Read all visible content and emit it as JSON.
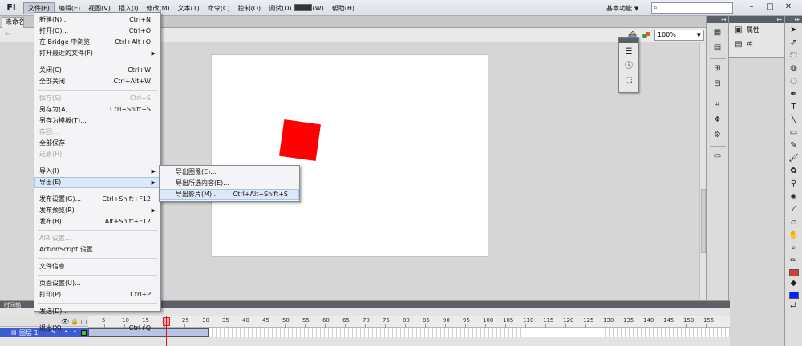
{
  "app": {
    "logo": "Fl"
  },
  "menubar": [
    {
      "label": "文件(F)"
    },
    {
      "label": "编辑(E)"
    },
    {
      "label": "视图(V)"
    },
    {
      "label": "插入(I)"
    },
    {
      "label": "修改(M)"
    },
    {
      "label": "文本(T)"
    },
    {
      "label": "命令(C)"
    },
    {
      "label": "控制(O)"
    },
    {
      "label": "调试(D)"
    },
    {
      "label": "窗口(W)"
    },
    {
      "label": "帮助(H)"
    }
  ],
  "workspace": {
    "label": "基本功能"
  },
  "search": {
    "placeholder": ""
  },
  "document": {
    "tab_label": "未命名"
  },
  "zoom": {
    "value": "100%"
  },
  "file_menu": {
    "items": [
      {
        "label": "新建(N)...",
        "shortcut": "Ctrl+N"
      },
      {
        "label": "打开(O)...",
        "shortcut": "Ctrl+O"
      },
      {
        "label": "在 Bridge 中浏览",
        "shortcut": "Ctrl+Alt+O"
      },
      {
        "label": "打开最近的文件(F)",
        "shortcut": ""
      },
      {
        "label": "关闭(C)",
        "shortcut": "Ctrl+W"
      },
      {
        "label": "全部关闭",
        "shortcut": "Ctrl+Alt+W"
      },
      {
        "label": "保存(S)",
        "shortcut": "Ctrl+S"
      },
      {
        "label": "另存为(A)...",
        "shortcut": "Ctrl+Shift+S"
      },
      {
        "label": "另存为模板(T)...",
        "shortcut": ""
      },
      {
        "label": "存回...",
        "shortcut": ""
      },
      {
        "label": "全部保存",
        "shortcut": ""
      },
      {
        "label": "还原(H)",
        "shortcut": ""
      },
      {
        "label": "导入(I)",
        "shortcut": ""
      },
      {
        "label": "导出(E)",
        "shortcut": ""
      },
      {
        "label": "发布设置(G)...",
        "shortcut": "Ctrl+Shift+F12"
      },
      {
        "label": "发布预览(R)",
        "shortcut": ""
      },
      {
        "label": "发布(B)",
        "shortcut": "Alt+Shift+F12"
      },
      {
        "label": "AIR 设置...",
        "shortcut": ""
      },
      {
        "label": "ActionScript 设置...",
        "shortcut": ""
      },
      {
        "label": "文件信息...",
        "shortcut": ""
      },
      {
        "label": "页面设置(U)...",
        "shortcut": ""
      },
      {
        "label": "打印(P)...",
        "shortcut": "Ctrl+P"
      },
      {
        "label": "发送(D)...",
        "shortcut": ""
      },
      {
        "label": "退出(X)",
        "shortcut": "Ctrl+Q"
      }
    ]
  },
  "export_submenu": {
    "items": [
      {
        "label": "导出图像(E)...",
        "shortcut": ""
      },
      {
        "label": "导出所选内容(E)...",
        "shortcut": ""
      },
      {
        "label": "导出影片(M)...",
        "shortcut": "Ctrl+Alt+Shift+S"
      }
    ]
  },
  "right_panel": {
    "items": [
      {
        "label": "属性"
      },
      {
        "label": "库"
      }
    ]
  },
  "timeline": {
    "tab_label": "时间轴",
    "layer_name": "图层 1",
    "ruler": [
      "5",
      "10",
      "15",
      "20",
      "25",
      "30",
      "35",
      "40",
      "45",
      "50",
      "55",
      "60",
      "65",
      "70",
      "75",
      "80",
      "85",
      "90",
      "95",
      "100",
      "105",
      "110",
      "115",
      "120",
      "125",
      "130",
      "135",
      "140",
      "145",
      "150",
      "155"
    ],
    "current_frame": 20
  },
  "colors": {
    "stroke_color": "#d93a3a",
    "fill_color": "#0022ff",
    "shape_color": "#ff0000"
  }
}
